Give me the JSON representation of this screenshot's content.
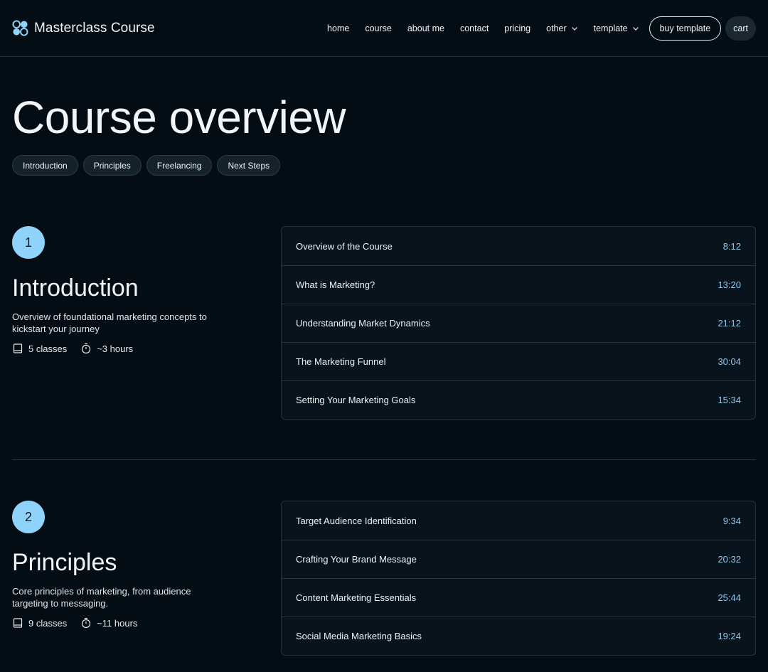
{
  "brand": {
    "name": "Masterclass Course"
  },
  "nav": {
    "links": [
      "home",
      "course",
      "about me",
      "contact",
      "pricing"
    ],
    "dropdowns": [
      "other",
      "template"
    ],
    "buy_label": "buy template",
    "cart_label": "cart"
  },
  "hero": {
    "title": "Course overview",
    "pills": [
      "Introduction",
      "Principles",
      "Freelancing",
      "Next Steps"
    ]
  },
  "sections": [
    {
      "number": "1",
      "title": "Introduction",
      "description": "Overview of foundational marketing concepts to kickstart your journey",
      "classes": "5 classes",
      "hours": "~3 hours",
      "lessons": [
        {
          "title": "Overview of the Course",
          "time": "8:12"
        },
        {
          "title": "What is Marketing?",
          "time": "13:20"
        },
        {
          "title": "Understanding Market Dynamics",
          "time": "21:12"
        },
        {
          "title": "The Marketing Funnel",
          "time": "30:04"
        },
        {
          "title": "Setting Your Marketing Goals",
          "time": "15:34"
        }
      ]
    },
    {
      "number": "2",
      "title": "Principles",
      "description": "Core principles of marketing, from audience targeting to messaging.",
      "classes": "9 classes",
      "hours": "~11 hours",
      "lessons": [
        {
          "title": "Target Audience Identification",
          "time": "9:34"
        },
        {
          "title": "Crafting Your Brand Message",
          "time": "20:32"
        },
        {
          "title": "Content Marketing Essentials",
          "time": "25:44"
        },
        {
          "title": "Social Media Marketing Basics",
          "time": "19:24"
        }
      ]
    }
  ],
  "icons": {
    "logo": "logo-icon",
    "chevron": "chevron-down-icon",
    "book": "book-icon",
    "timer": "timer-icon"
  },
  "colors": {
    "background": "#050d14",
    "accent_circle": "#8fd3fb",
    "time_text": "#8fc9ef"
  }
}
